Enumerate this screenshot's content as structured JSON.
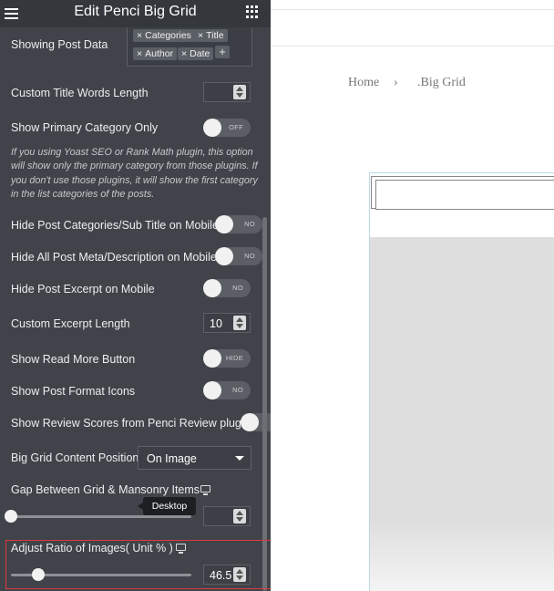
{
  "header": {
    "title": "Edit Penci Big Grid"
  },
  "showing_post_data": {
    "label": "Showing Post Data",
    "tags": [
      "Categories",
      "Title",
      "Author",
      "Date"
    ],
    "add_label": "+"
  },
  "title_words": {
    "label": "Custom Title Words Length",
    "value": ""
  },
  "primary_category": {
    "label": "Show Primary Category Only",
    "toggle": "OFF",
    "note": "If you using Yoast SEO or Rank Math plugin, this option will show only the primary category from those plugins. If you don't use those plugins, it will show the first category in the list categories of the posts."
  },
  "hide_categories": {
    "label": "Hide Post Categories/Sub Title on Mobile",
    "toggle": "NO"
  },
  "hide_meta": {
    "label": "Hide All Post Meta/Description on Mobile",
    "toggle": "NO"
  },
  "hide_excerpt": {
    "label": "Hide Post Excerpt on Mobile",
    "toggle": "NO"
  },
  "excerpt_length": {
    "label": "Custom Excerpt Length",
    "value": "10"
  },
  "read_more": {
    "label": "Show Read More Button",
    "toggle": "HIDE"
  },
  "post_format": {
    "label": "Show Post Format Icons",
    "toggle": "NO"
  },
  "review_scores": {
    "label": "Show Review Scores from Penci Review plugin"
  },
  "content_position": {
    "label": "Big Grid Content Position",
    "value": "On Image"
  },
  "gap": {
    "label": "Gap Between Grid & Mansonry Items",
    "tooltip": "Desktop",
    "value": "",
    "slider": 0
  },
  "ratio": {
    "label": "Adjust Ratio of Images( Unit % )",
    "value": "46.5",
    "slider": 0.15
  },
  "preview": {
    "breadcrumb": {
      "home": "Home",
      "separator": "›",
      "current": ".Big Grid"
    }
  }
}
